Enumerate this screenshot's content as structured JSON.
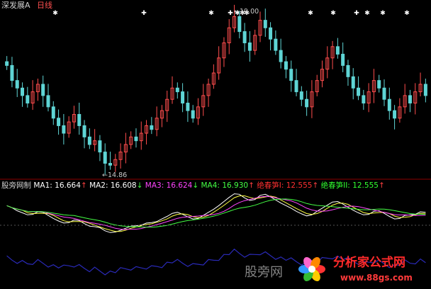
{
  "header": {
    "title": "深发展A",
    "period": "日线"
  },
  "annotations": {
    "high": "19.00",
    "low": "14.86"
  },
  "indicator": {
    "name": "股旁网制",
    "ma1_label": "MA1:",
    "ma1_value": "16.664",
    "ma1_dir": "↑",
    "ma2_label": "MA2:",
    "ma2_value": "16.608",
    "ma2_dir": "↓",
    "ma3_label": "MA3:",
    "ma3_value": "16.624",
    "ma3_dir": "↓",
    "ma4_label": "MA4:",
    "ma4_value": "16.930",
    "ma4_dir": "↑",
    "line1_label": "绝春笋I:",
    "line1_value": "12.555",
    "line1_dir": "↑",
    "line2_label": "绝春笋II:",
    "line2_value": "12.555",
    "line2_dir": "↑"
  },
  "watermark": {
    "text": "股旁网",
    "logo_main": "分析家公式网",
    "logo_url": "www.88gs.com"
  },
  "colors": {
    "background": "#000000",
    "up_candle": "#ff4d4d",
    "down_candle": "#5fd5d5",
    "ma1": "#ffffff",
    "ma2": "#ffff44",
    "ma3": "#ff44ff",
    "ma4": "#44ff44",
    "line1": "#ff3030",
    "line2": "#30ff30",
    "blue_line": "#2a2ab8"
  },
  "chart_data": {
    "type": "candlestick",
    "price_range": [
      14.86,
      19.0
    ],
    "annotated_low": 14.86,
    "annotated_high": 19.0,
    "signal_markers": [
      "✱",
      "✚",
      "✱",
      "✚",
      "✱",
      "✱",
      "✱",
      "✱",
      "✱",
      "✚",
      "✱",
      "✱",
      "✱"
    ],
    "closes": [
      17.6,
      17.2,
      17.0,
      16.8,
      16.6,
      16.9,
      17.1,
      16.8,
      16.5,
      16.2,
      16.0,
      15.8,
      16.1,
      16.3,
      16.0,
      15.7,
      15.5,
      15.6,
      15.3,
      15.0,
      14.95,
      15.1,
      15.3,
      15.5,
      15.7,
      15.6,
      15.8,
      16.0,
      15.9,
      16.2,
      16.4,
      16.7,
      17.0,
      16.9,
      16.6,
      16.4,
      16.2,
      16.5,
      16.8,
      17.1,
      17.4,
      17.8,
      18.2,
      18.6,
      18.9,
      18.5,
      18.2,
      18.0,
      18.4,
      18.8,
      18.6,
      18.3,
      18.0,
      17.7,
      17.5,
      17.2,
      16.9,
      16.7,
      16.5,
      16.9,
      17.2,
      17.5,
      17.8,
      18.1,
      17.9,
      17.6,
      17.3,
      17.0,
      16.8,
      16.6,
      16.9,
      17.2,
      17.0,
      16.7,
      16.4,
      16.2,
      16.5,
      16.8,
      16.6,
      16.9,
      17.1,
      16.8
    ]
  }
}
